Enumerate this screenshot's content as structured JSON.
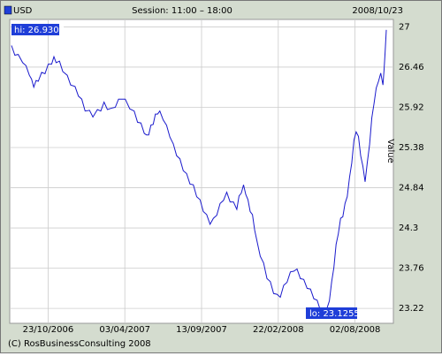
{
  "header": {
    "currency": "USD",
    "session": "Session: 11:00 – 18:00",
    "date": "2008/10/23"
  },
  "footer": {
    "copyright": "(C) RosBusinessConsulting 2008"
  },
  "colors": {
    "line": "#1a1acc",
    "flag_bg": "#1f3ed8",
    "grid": "#cccccc",
    "frame_bg": "#d4dccf"
  },
  "chart_data": {
    "type": "line",
    "title": "",
    "xlabel": "",
    "ylabel": "Value",
    "x_tick_labels": [
      "23/10/2006",
      "03/04/2007",
      "13/09/2007",
      "22/02/2008",
      "02/08/2008"
    ],
    "y_ticks": [
      23.22,
      23.76,
      24.3,
      24.84,
      25.38,
      25.92,
      26.46,
      27
    ],
    "ylim": [
      23.02,
      27.1
    ],
    "grid": true,
    "hi_label": "hi: 26.9307",
    "lo_label": "lo: 23.1255",
    "series": [
      {
        "name": "USD",
        "points": [
          [
            0,
            26.72
          ],
          [
            3,
            26.65
          ],
          [
            6,
            26.6
          ],
          [
            10,
            26.55
          ],
          [
            13,
            26.45
          ],
          [
            16,
            26.38
          ],
          [
            18,
            26.27
          ],
          [
            20,
            26.22
          ],
          [
            22,
            26.25
          ],
          [
            24,
            26.3
          ],
          [
            27,
            26.36
          ],
          [
            30,
            26.4
          ],
          [
            33,
            26.47
          ],
          [
            36,
            26.53
          ],
          [
            38,
            26.57
          ],
          [
            40,
            26.55
          ],
          [
            43,
            26.51
          ],
          [
            46,
            26.43
          ],
          [
            50,
            26.32
          ],
          [
            53,
            26.25
          ],
          [
            57,
            26.17
          ],
          [
            60,
            26.1
          ],
          [
            63,
            26.0
          ],
          [
            66,
            25.9
          ],
          [
            70,
            25.85
          ],
          [
            73,
            25.82
          ],
          [
            77,
            25.86
          ],
          [
            80,
            25.9
          ],
          [
            83,
            25.96
          ],
          [
            86,
            25.92
          ],
          [
            90,
            25.88
          ],
          [
            93,
            25.95
          ],
          [
            96,
            26.0
          ],
          [
            99,
            26.06
          ],
          [
            102,
            26.0
          ],
          [
            106,
            25.93
          ],
          [
            110,
            25.84
          ],
          [
            113,
            25.75
          ],
          [
            116,
            25.68
          ],
          [
            119,
            25.6
          ],
          [
            121,
            25.52
          ],
          [
            123,
            25.58
          ],
          [
            125,
            25.65
          ],
          [
            127,
            25.72
          ],
          [
            129,
            25.8
          ],
          [
            131,
            25.86
          ],
          [
            133,
            25.84
          ],
          [
            136,
            25.78
          ],
          [
            139,
            25.65
          ],
          [
            142,
            25.55
          ],
          [
            145,
            25.4
          ],
          [
            148,
            25.3
          ],
          [
            151,
            25.2
          ],
          [
            154,
            25.1
          ],
          [
            157,
            25.0
          ],
          [
            160,
            24.92
          ],
          [
            163,
            24.85
          ],
          [
            166,
            24.75
          ],
          [
            169,
            24.65
          ],
          [
            172,
            24.55
          ],
          [
            175,
            24.45
          ],
          [
            178,
            24.38
          ],
          [
            181,
            24.4
          ],
          [
            184,
            24.5
          ],
          [
            187,
            24.6
          ],
          [
            190,
            24.7
          ],
          [
            193,
            24.75
          ],
          [
            196,
            24.68
          ],
          [
            199,
            24.62
          ],
          [
            202,
            24.58
          ],
          [
            204,
            24.7
          ],
          [
            206,
            24.8
          ],
          [
            208,
            24.85
          ],
          [
            210,
            24.78
          ],
          [
            212,
            24.65
          ],
          [
            214,
            24.55
          ],
          [
            216,
            24.45
          ],
          [
            218,
            24.3
          ],
          [
            220,
            24.1
          ],
          [
            223,
            23.95
          ],
          [
            226,
            23.8
          ],
          [
            229,
            23.65
          ],
          [
            232,
            23.55
          ],
          [
            235,
            23.45
          ],
          [
            238,
            23.38
          ],
          [
            241,
            23.4
          ],
          [
            244,
            23.5
          ],
          [
            247,
            23.6
          ],
          [
            250,
            23.68
          ],
          [
            253,
            23.75
          ],
          [
            256,
            23.72
          ],
          [
            259,
            23.65
          ],
          [
            262,
            23.58
          ],
          [
            265,
            23.52
          ],
          [
            268,
            23.45
          ],
          [
            271,
            23.38
          ],
          [
            274,
            23.3
          ],
          [
            277,
            23.22
          ],
          [
            279,
            23.15
          ],
          [
            281,
            23.13
          ],
          [
            283,
            23.2
          ],
          [
            285,
            23.35
          ],
          [
            287,
            23.55
          ],
          [
            289,
            23.8
          ],
          [
            291,
            24.05
          ],
          [
            293,
            24.25
          ],
          [
            295,
            24.4
          ],
          [
            297,
            24.48
          ],
          [
            299,
            24.6
          ],
          [
            301,
            24.75
          ],
          [
            303,
            24.95
          ],
          [
            305,
            25.2
          ],
          [
            307,
            25.45
          ],
          [
            309,
            25.62
          ],
          [
            311,
            25.5
          ],
          [
            313,
            25.3
          ],
          [
            315,
            25.1
          ],
          [
            317,
            24.95
          ],
          [
            319,
            25.15
          ],
          [
            321,
            25.45
          ],
          [
            323,
            25.75
          ],
          [
            325,
            26.0
          ],
          [
            327,
            26.15
          ],
          [
            329,
            26.3
          ],
          [
            331,
            26.35
          ],
          [
            333,
            26.25
          ],
          [
            334,
            26.4
          ],
          [
            335,
            26.7
          ],
          [
            336,
            26.93
          ]
        ]
      }
    ]
  }
}
